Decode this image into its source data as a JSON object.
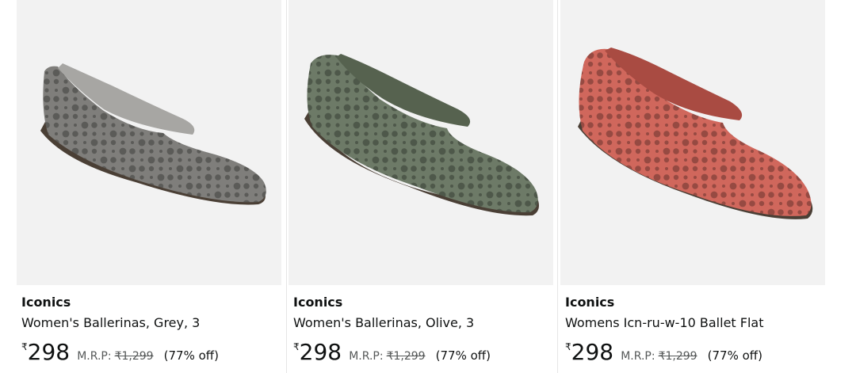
{
  "products": [
    {
      "brand": "Iconics",
      "title": "Women's Ballerinas, Grey, 3",
      "currency": "₹",
      "price": "298",
      "mrp_label": "M.R.P:",
      "mrp_value": "₹1,299",
      "discount": "(77% off)",
      "color": "#7f7e7b",
      "inner_color": "#a7a6a3",
      "sole_color": "#4a3f35"
    },
    {
      "brand": "Iconics",
      "title": "Women's Ballerinas, Olive, 3",
      "currency": "₹",
      "price": "298",
      "mrp_label": "M.R.P:",
      "mrp_value": "₹1,299",
      "discount": "(77% off)",
      "color": "#6d7a67",
      "inner_color": "#56624f",
      "sole_color": "#4a3f35"
    },
    {
      "brand": "Iconics",
      "title": "Womens Icn-ru-w-10 Ballet Flat",
      "currency": "₹",
      "price": "298",
      "mrp_label": "M.R.P:",
      "mrp_value": "₹1,299",
      "discount": "(77% off)",
      "color": "#d0675c",
      "inner_color": "#a94b42",
      "sole_color": "#4a3f35"
    }
  ]
}
